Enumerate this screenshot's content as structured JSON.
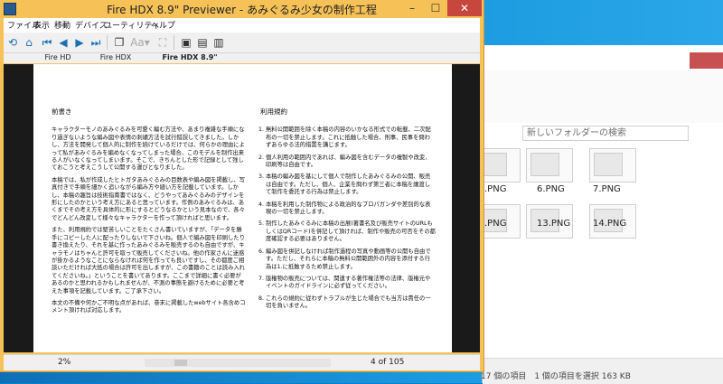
{
  "window": {
    "title": "Fire HDX 8.9\" Previewer - あみぐるみ少女の制作工程",
    "minimize": "–",
    "maximize": "☐",
    "close": "✕"
  },
  "menu": [
    "ファイル",
    "表示",
    "移動",
    "デバイス",
    "ユーティリティ",
    "ヘルプ"
  ],
  "tabs": [
    "Fire HD",
    "Fire HDX",
    "Fire HDX 8.9\""
  ],
  "page": {
    "left": {
      "heading": "前書き",
      "paragraphs": [
        "キャラクターモノのあみぐるみを可愛く編む方法や、あまり複雑な手順になり過ぎないような編み図や表情の刺繍方法を試行錯誤してきました。しかし、方法を開発して個人的に制作を続けているだけでは、何らかの理由によって私があみぐるみを編めなくなってしまった場合、このモデルを制作出来る人がいなくなってしまいます。そこで、きちんとした形で記録として残しておこうと考えこうして公開する運びとなりました。",
        "本稿では、私が作成したヒトガタあみぐるみの目数表や編み図を掲載し、写真付きで手順を細かく追いながら編み方や縫い方を記載しています。しかし、本稿の趣旨は技術指南書ではなく、どうやってあみぐるみのデザインを形にしたのかという考え方にあると思っています。作例のあみぐるみは、あくまでその考え方を具体的に形にするとどうなるかという見本なので、各々でどんどん改変して様々なキャラクターを作って頂ければと思います。",
        "また、利用規約では堅苦しいことをたくさん書いていますが、「データを勝手にコピーした人に配ったりしないで下さいね。個人で編み図を印刷したり書き換えたり、それを基に作ったあみぐるみを販売するのも自由ですが、キャラモノはちゃんと許可を取って販売してくださいね。他の作家さんに迷惑が掛かるようなことにならなければ何を作っても良いですし、その都度ご相談いただければ大抵の場合は許可を出しますが、この書籍のことは読み入れてくださいね。」ということを書いてあります。ここまで詳細に書く必要があるのかと思われるかもしれませんが、不測の事態を避けるために必要と考えた事項を記載しています。ご了承下さい。",
        "本文の不備や何かご不明な点があれば、巻末に掲載したwebサイト各含めコメント頂ければ対応します。"
      ]
    },
    "right": {
      "heading": "利用規約",
      "items": [
        "無料公開範囲を除く本稿の内容のいかなる形式での転載、二次配布の一切を禁止します。これに抵触した場合、刑事、民事を問わずあらゆる法的措置を講じます。",
        "個人利用の範囲内であれば、編み図を含むデータの複製や改変、印刷等は自由です。",
        "本稿の編み図を基にして個人で制作したあみぐるみの公開、販売は自由です。ただし、個人、企業を問わず第三者に本稿を譲渡して制作を委託する行為は禁止します。",
        "本稿を利用した制作物による政治的なプロパガンダや差別的な表現の一切を禁止します。",
        "制作したあみぐるみに本稿の出展(著書名及び販売サイトのURLもしくはQRコード)を併記して頂ければ、制作や販売の可否をその都度確認する必要はありません。",
        "編み図を併記しなければ制作過程の写真や動画等の公開も自由です。ただし、それらに本稿の無料公開範囲外の内容を添付する行為は1.に抵触するため禁止します。",
        "版権物の販売については、関連する著作権法等の法律、版権元やイベントのガイドラインに必ず従ってください。",
        "これらの規約に従わずトラブルが生じた場合でも当方は責任の一切を負いません。"
      ]
    }
  },
  "status": {
    "zoom": "2%",
    "page": "4 of 105"
  },
  "explorer": {
    "search_placeholder": "新しいフォルダーの検索",
    "thumbs": [
      ".PNG",
      "6.PNG",
      "7.PNG",
      ".PNG",
      "13.PNG",
      "14.PNG"
    ],
    "status": "17 個の項目　1 個の項目を選択 163 KB"
  }
}
